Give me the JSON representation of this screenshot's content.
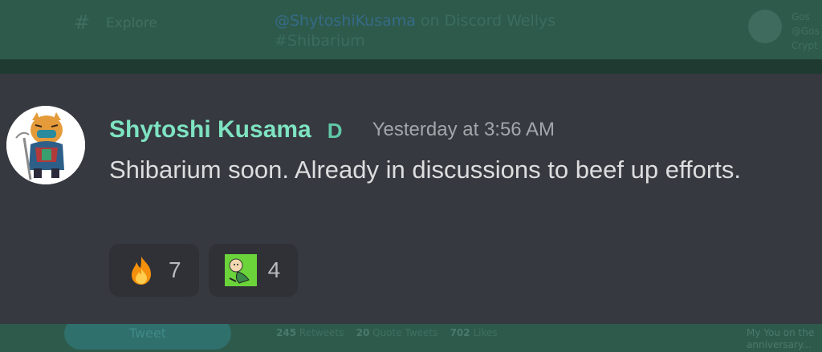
{
  "background": {
    "nav": {
      "hash_symbol": "#",
      "explore_label": "Explore"
    },
    "tweet": {
      "mention": "@ShytoshiKusama",
      "text_suffix": " on Discord  Wellys",
      "hashtag": "#Shibarium"
    },
    "profile": {
      "name": "Gos",
      "handle": "@Gos",
      "bio": "Crypt"
    },
    "tweet_button_label": "Tweet",
    "stats": {
      "retweets_count": "245",
      "retweets_label": "Retweets",
      "quotes_count": "20",
      "quotes_label": "Quote Tweets",
      "likes_count": "702",
      "likes_label": "Likes"
    },
    "right_note_line1": "My You on the",
    "right_note_line2": "anniversary..."
  },
  "message": {
    "username": "Shytoshi Kusama",
    "badge": "D",
    "timestamp": "Yesterday at 3:56 AM",
    "text": "Shibarium soon. Already in discussions to beef up efforts."
  },
  "reactions": [
    {
      "icon": "fire-emoji-icon",
      "count": "7"
    },
    {
      "icon": "custom-character-emoji-icon",
      "count": "4"
    }
  ],
  "colors": {
    "username": "#7ee3c1",
    "card_bg": "#36393f",
    "reaction_bg": "#2f3136",
    "text": "#dcddde",
    "timestamp": "#a3a6aa"
  }
}
